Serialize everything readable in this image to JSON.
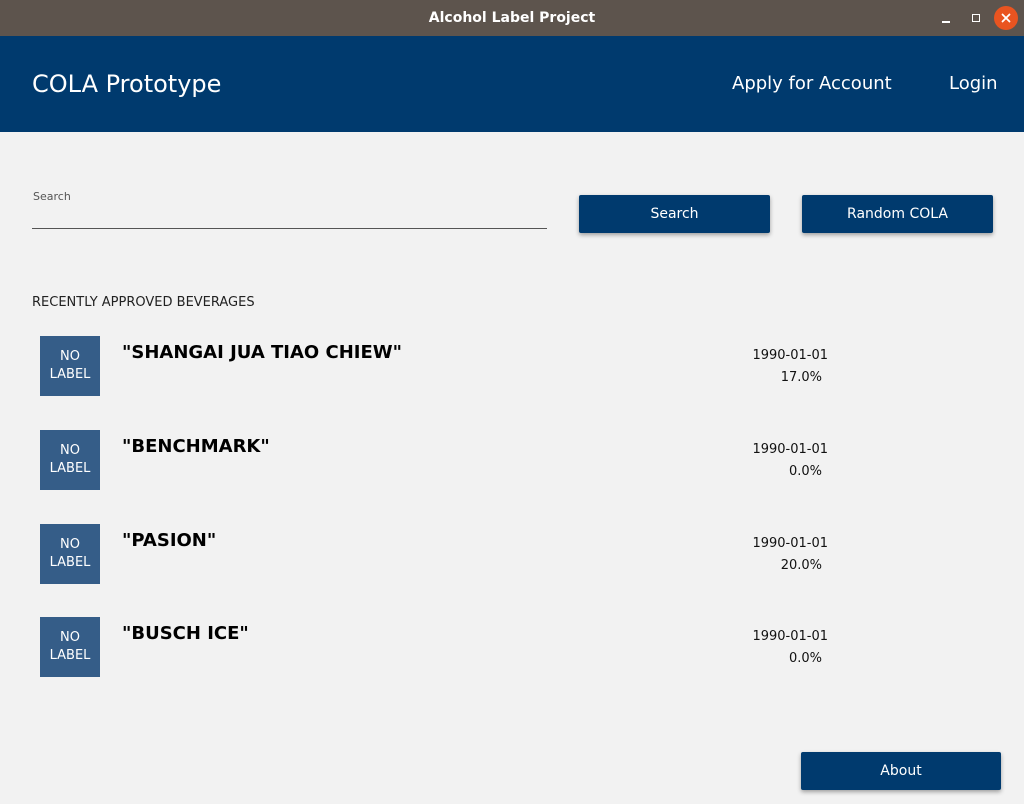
{
  "window": {
    "title": "Alcohol Label Project",
    "accent_close": "#e95420",
    "titlebar_color": "#5d544d"
  },
  "header": {
    "app_title": "COLA Prototype",
    "nav": {
      "apply": "Apply for Account",
      "login": "Login"
    },
    "color": "#003a6e"
  },
  "search": {
    "label": "Search",
    "value": "",
    "search_button": "Search",
    "random_button": "Random COLA"
  },
  "recent": {
    "title": "RECENTLY APPROVED BEVERAGES",
    "no_label_line1": "NO",
    "no_label_line2": "LABEL",
    "items": [
      {
        "name": "\"SHANGAI JUA TIAO CHIEW\"",
        "date": "1990-01-01",
        "abv": "17.0%"
      },
      {
        "name": "\"BENCHMARK\"",
        "date": "1990-01-01",
        "abv": "0.0%"
      },
      {
        "name": "\"PASION\"",
        "date": "1990-01-01",
        "abv": "20.0%"
      },
      {
        "name": "\"BUSCH ICE\"",
        "date": "1990-01-01",
        "abv": "0.0%"
      }
    ]
  },
  "footer": {
    "about_button": "About"
  },
  "icons": {
    "minimize": "minimize-icon",
    "maximize": "maximize-icon",
    "close": "close-icon"
  }
}
